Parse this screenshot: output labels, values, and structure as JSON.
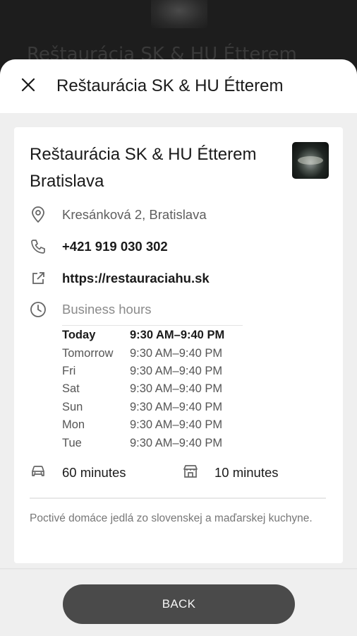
{
  "backdrop": {
    "title": "Reštaurácia SK & HU Étterem"
  },
  "header": {
    "title": "Reštaurácia SK & HU Étterem"
  },
  "place": {
    "name": "Reštaurácia SK & HU Étterem Bratislava",
    "address": "Kresánková 2, Bratislava",
    "phone": "+421 919 030 302",
    "website": "https://restauraciahu.sk",
    "hours_label": "Business hours",
    "hours": [
      {
        "day": "Today",
        "time": "9:30 AM–9:40 PM"
      },
      {
        "day": "Tomorrow",
        "time": "9:30 AM–9:40 PM"
      },
      {
        "day": "Fri",
        "time": "9:30 AM–9:40 PM"
      },
      {
        "day": "Sat",
        "time": "9:30 AM–9:40 PM"
      },
      {
        "day": "Sun",
        "time": "9:30 AM–9:40 PM"
      },
      {
        "day": "Mon",
        "time": "9:30 AM–9:40 PM"
      },
      {
        "day": "Tue",
        "time": "9:30 AM–9:40 PM"
      }
    ],
    "drive_time": "60 minutes",
    "transit_time": "10 minutes",
    "description": "Poctivé domáce jedlá zo slovenskej a maďarskej kuchyne."
  },
  "footer": {
    "back_label": "BACK"
  },
  "colors": {
    "button": "#4a4a4a",
    "sheet_bg": "#efefef",
    "card_bg": "#ffffff"
  },
  "icons": [
    "close-icon",
    "location-pin-icon",
    "phone-icon",
    "external-link-icon",
    "clock-icon",
    "car-icon",
    "store-icon"
  ]
}
